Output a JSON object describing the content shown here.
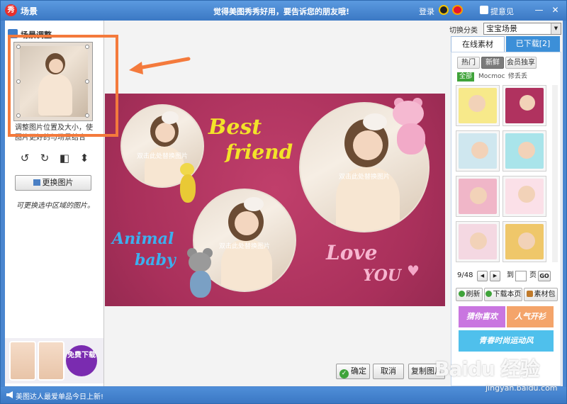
{
  "window": {
    "title": "场景",
    "slogan": "觉得美图秀秀好用，要告诉您的朋友哦!",
    "login": "登录",
    "feedback": "提意见",
    "minimize": "—",
    "close": "✕",
    "app_logo": "秀"
  },
  "left_panel": {
    "title": "场景调整",
    "caption": "调整图片位置及大小，使图片更好的与场景结合",
    "replace_button": "更换图片",
    "tip": "可更换选中区域的图片。",
    "tools": {
      "rotate_left": "↺",
      "rotate_right": "↻",
      "flip_h": "◧",
      "flip_v": "⬍"
    },
    "ad": {
      "cta": "免费下载"
    }
  },
  "canvas": {
    "replace_hint": "双击此处替换图片",
    "texts": {
      "best": "Best",
      "friend": "friend",
      "animal": "Animal",
      "baby": "baby",
      "love": "Love",
      "you": "YOU"
    },
    "heart": "♥",
    "background_color": "#b03560"
  },
  "bottom_buttons": {
    "ok": "确定",
    "cancel": "取消",
    "copy": "复制图片"
  },
  "right_panel": {
    "switch_label": "切换分类",
    "category": "宝宝场景",
    "tabs": {
      "online": "在线素材",
      "downloaded": "已下载[2]"
    },
    "subtabs": [
      "热门",
      "新鲜",
      "会员独享"
    ],
    "subtab_active": "新鲜",
    "filters": [
      "全部",
      "Mocmoc",
      "修丢丢"
    ],
    "pager": {
      "page": "9/48",
      "prev": "◀",
      "next": "▶",
      "goto": "到",
      "page_unit": "页",
      "go": "GO"
    },
    "actions": {
      "refresh": "刷新",
      "download_page": "下载本页",
      "package": "素材包"
    },
    "banners": {
      "guess": "猜你喜欢",
      "popular": "人气开衫",
      "youth": "青春时尚运动风"
    }
  },
  "statusbar": {
    "text": "美图达人最爱单品今日上新!"
  },
  "watermark": {
    "main": "Baidu 经验",
    "sub": "jingyan.baidu.com"
  }
}
